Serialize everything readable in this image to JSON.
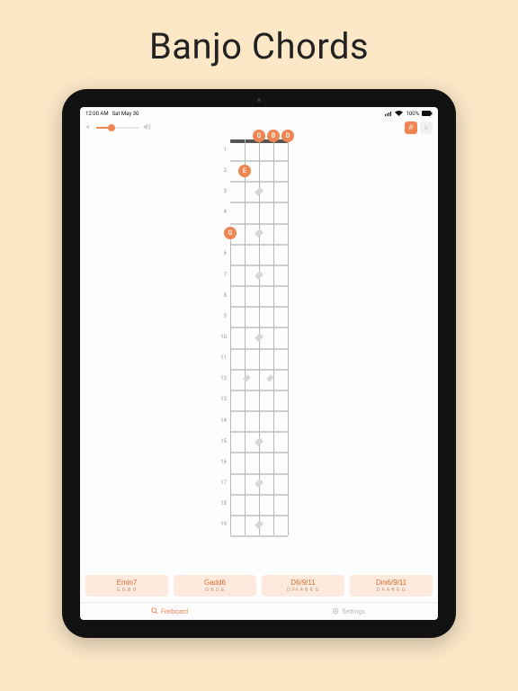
{
  "page": {
    "title": "Banjo Chords"
  },
  "status": {
    "time": "12:00 AM",
    "date": "Sat May 30",
    "battery": "100%"
  },
  "toolbar": {
    "volume_percent": 35,
    "sharp_label": "#",
    "flat_label": "♭",
    "active": "sharp"
  },
  "fretboard": {
    "num_frets": 19,
    "strings": 5,
    "short_string_index": 0,
    "open_notes": [
      {
        "string": 2,
        "label": "G"
      },
      {
        "string": 3,
        "label": "B"
      },
      {
        "string": 4,
        "label": "D"
      }
    ],
    "fretted_notes": [
      {
        "string": 1,
        "fret": 2,
        "label": "E"
      },
      {
        "string": 0,
        "fret": 5,
        "label": "G"
      }
    ],
    "inlays_single": [
      3,
      5,
      7,
      10,
      15,
      17,
      19
    ],
    "inlays_double": [
      12
    ]
  },
  "chords": [
    {
      "name": "Emin7",
      "notes": "E G B D"
    },
    {
      "name": "Gadd6",
      "notes": "G B D E"
    },
    {
      "name": "D6/9/11",
      "notes": "D F# A B E G"
    },
    {
      "name": "Dm6/9/11",
      "notes": "D F A B E G"
    }
  ],
  "tabs": {
    "fretboard_label": "Fretboard",
    "settings_label": "Settings",
    "active": "fretboard"
  }
}
